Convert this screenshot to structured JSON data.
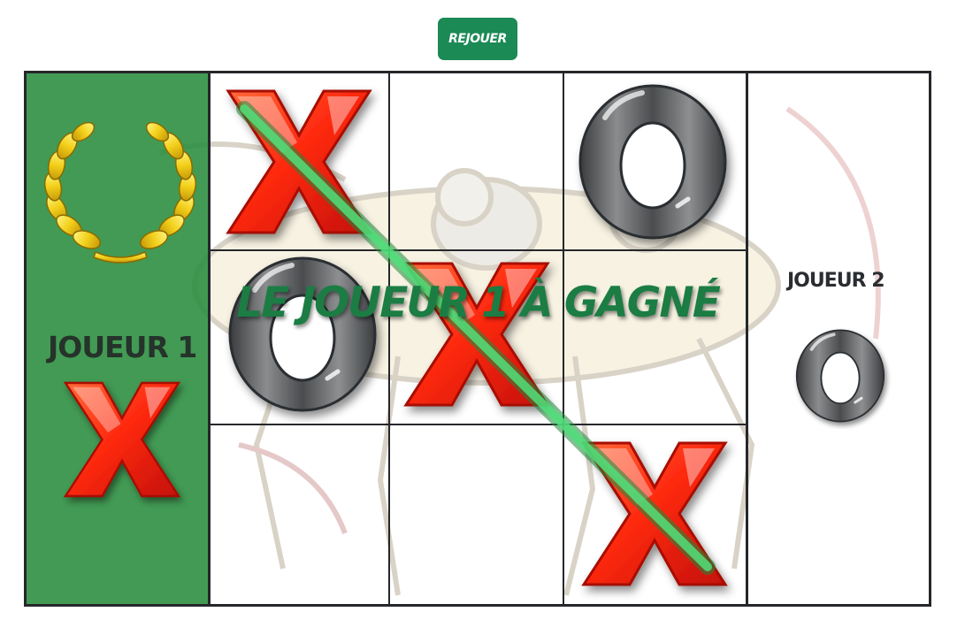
{
  "toolbar": {
    "replay_label": "Rejouer"
  },
  "players": {
    "player1": {
      "label": "Joueur 1",
      "symbol": "X",
      "winner": true
    },
    "player2": {
      "label": "Joueur 2",
      "symbol": "O",
      "winner": false
    }
  },
  "board": {
    "cells": [
      "X",
      "",
      "O",
      "O",
      "X",
      "",
      "",
      "",
      "X"
    ],
    "winning_line": "diagonal-top-left-to-bottom-right"
  },
  "result": {
    "message": "Le joueur 1 à gagné"
  },
  "colors": {
    "accent_green": "#1b8a55",
    "winner_panel": "#2e8c3f",
    "x_red": "#ff2a10",
    "o_gray": "#5a5c5e",
    "win_line": "#3fd46a",
    "laurel_gold": "#f2cf1a"
  },
  "icons": {
    "laurel": "laurel-wreath-icon",
    "x": "x-mark-icon",
    "o": "o-mark-icon"
  }
}
